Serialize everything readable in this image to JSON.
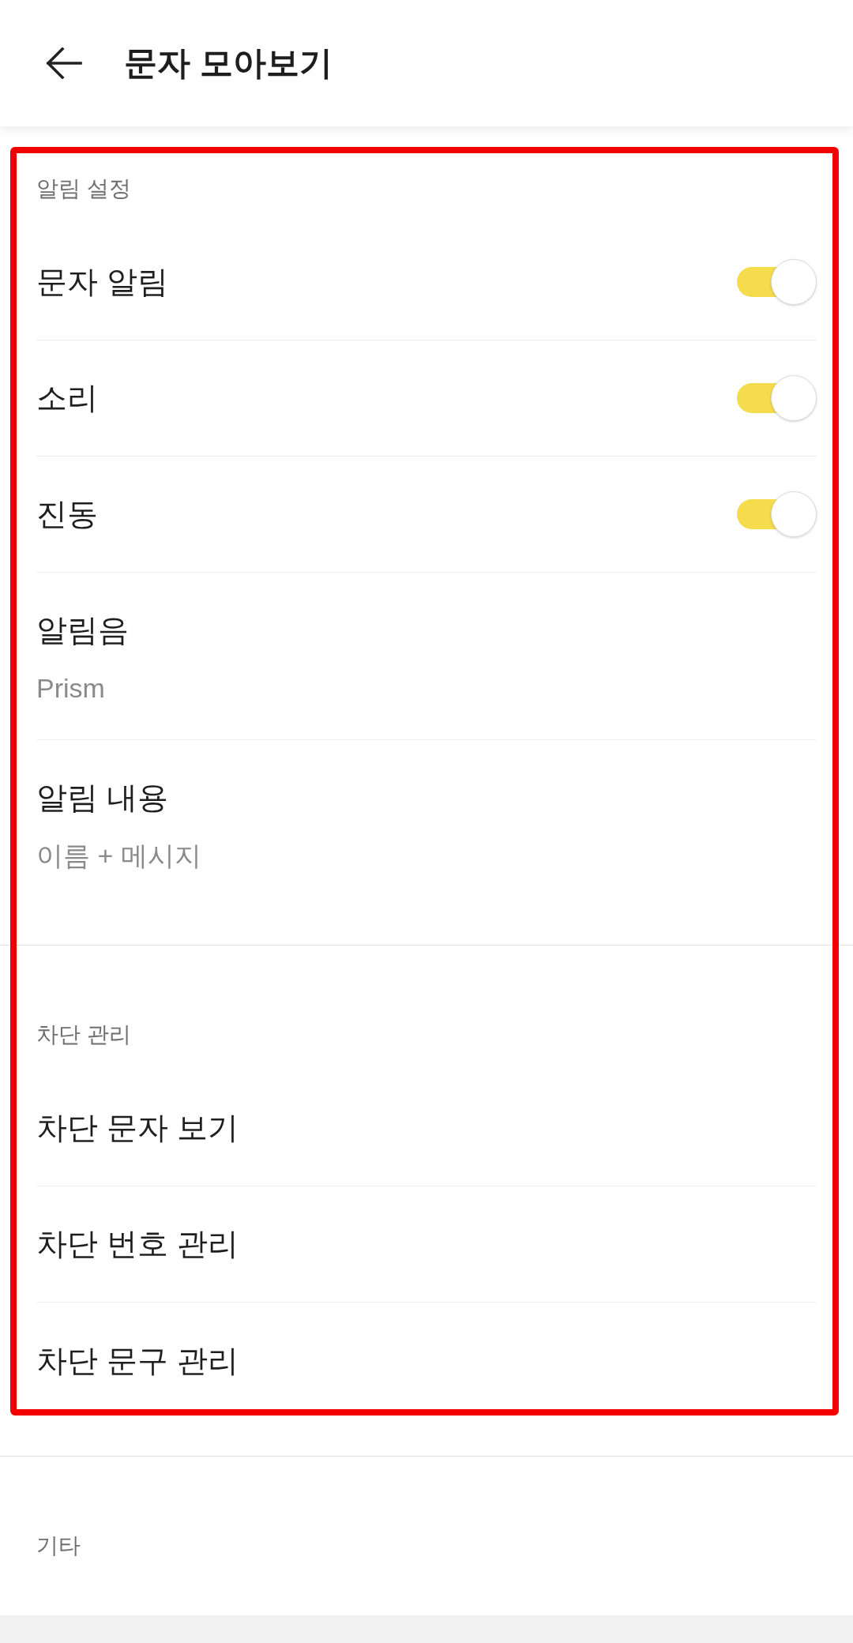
{
  "header": {
    "title": "문자 모아보기"
  },
  "sections": [
    {
      "title": "알림 설정",
      "highlighted": true,
      "items": [
        {
          "kind": "toggle",
          "label": "문자 알림",
          "on": true
        },
        {
          "kind": "toggle",
          "label": "소리",
          "on": true
        },
        {
          "kind": "toggle",
          "label": "진동",
          "on": true
        },
        {
          "kind": "value",
          "label": "알림음",
          "value": "Prism"
        },
        {
          "kind": "value",
          "label": "알림 내용",
          "value": "이름 + 메시지"
        }
      ]
    },
    {
      "title": "차단 관리",
      "highlighted": true,
      "items": [
        {
          "kind": "link",
          "label": "차단 문자 보기"
        },
        {
          "kind": "link",
          "label": "차단 번호 관리"
        },
        {
          "kind": "link",
          "label": "차단 문구 관리"
        }
      ]
    },
    {
      "title": "기타",
      "highlighted": false
    }
  ]
}
